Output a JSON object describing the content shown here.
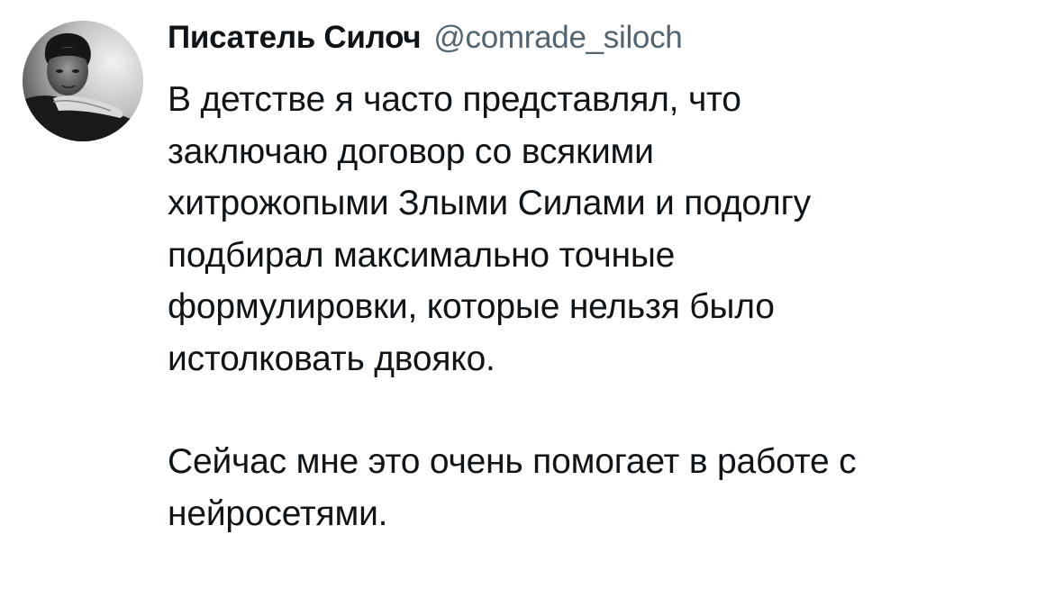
{
  "tweet": {
    "author": {
      "display_name": "Писатель Силоч",
      "handle": "@comrade_siloch",
      "avatar_icon": "profile-photo"
    },
    "paragraphs": [
      "В детстве я часто представлял, что\nзаключаю договор со всякими\nхитрожопыми Злыми Силами и подолгу\nподбирал максимально точные\nформулировки, которые нельзя было\nистолковать двояко.",
      "Сейчас мне это очень помогает в работе с\nнейросетями."
    ]
  },
  "colors": {
    "text": "#0f1419",
    "handle": "#536471",
    "background": "#ffffff"
  }
}
